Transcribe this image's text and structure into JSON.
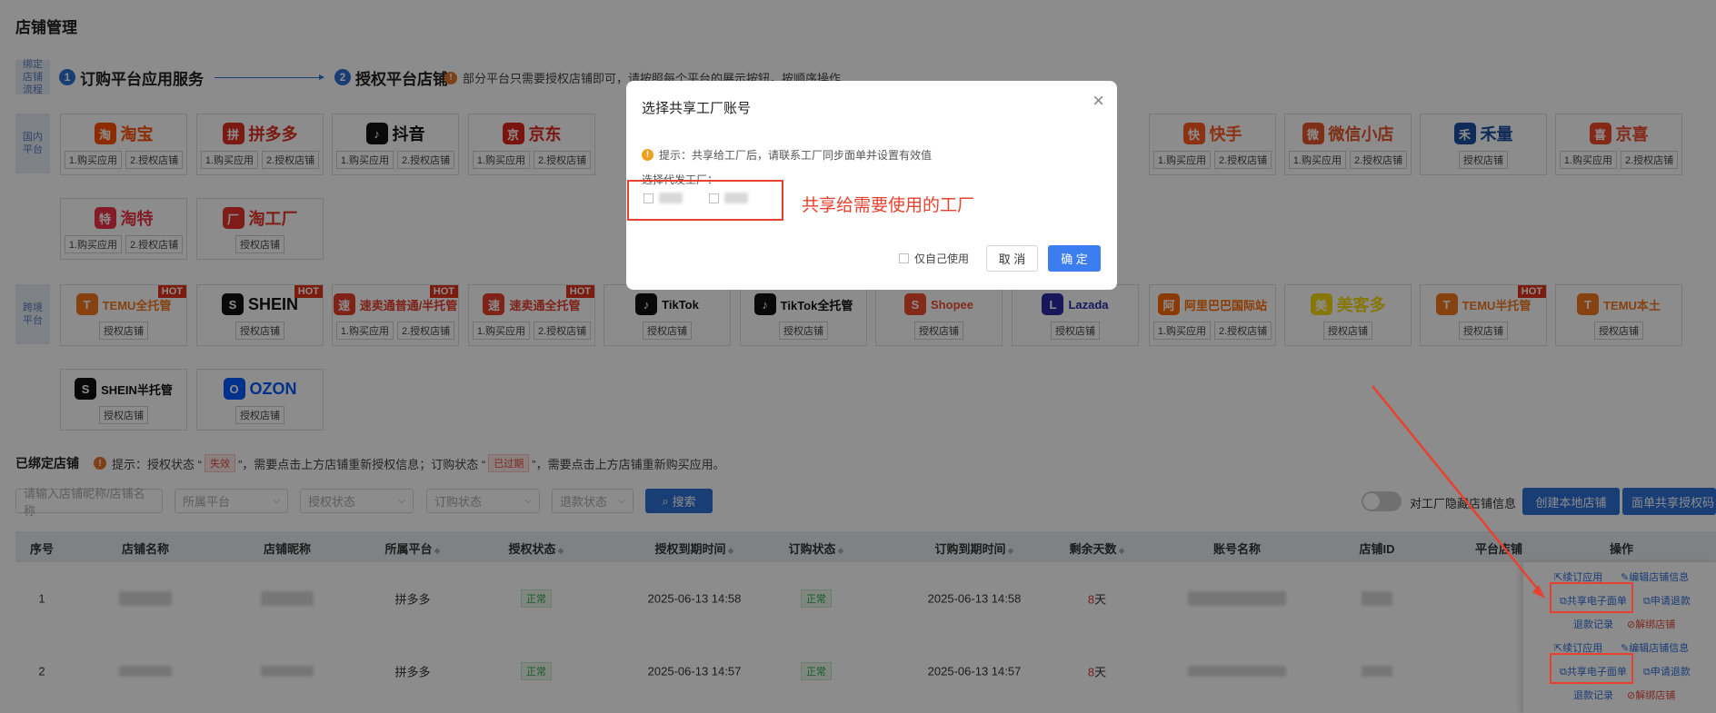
{
  "page": {
    "title": "店铺管理"
  },
  "flow": {
    "side_label": "绑定店铺流程",
    "step1": {
      "num": "1",
      "label": "订购平台应用服务"
    },
    "step2": {
      "num": "2",
      "label": "授权平台店铺"
    },
    "tip": "部分平台只需要授权店铺即可，请按照每个平台的展示按钮，按顺序操作"
  },
  "domestic": {
    "side_label": "国内平台",
    "platforms": [
      {
        "name": "淘宝",
        "mark": "淘",
        "color": "#ff5000",
        "btns": [
          "1.购买应用",
          "2.授权店铺"
        ]
      },
      {
        "name": "拼多多",
        "mark": "拼",
        "color": "#e02e24",
        "btns": [
          "1.购买应用",
          "2.授权店铺"
        ]
      },
      {
        "name": "抖音",
        "mark": "♪",
        "color": "#111111",
        "btns": [
          "1.购买应用",
          "2.授权店铺"
        ]
      },
      {
        "name": "京东",
        "mark": "京",
        "color": "#e1251b",
        "btns": [
          "1.购买应用",
          "2.授权店铺"
        ]
      },
      {
        "name": "快手",
        "mark": "快",
        "color": "#ff5a1f",
        "btns": [
          "1.购买应用",
          "2.授权店铺"
        ]
      },
      {
        "name": "微信小店",
        "mark": "微",
        "color": "#e8572a",
        "btns": [
          "1.购买应用",
          "2.授权店铺"
        ]
      },
      {
        "name": "禾量",
        "mark": "禾",
        "color": "#1d4fa5",
        "btns": [
          "授权店铺"
        ]
      },
      {
        "name": "京喜",
        "mark": "喜",
        "color": "#f04a2a",
        "btns": [
          "1.购买应用",
          "2.授权店铺"
        ]
      },
      {
        "name": "淘特",
        "mark": "特",
        "color": "#f0334a",
        "btns": [
          "1.购买应用",
          "2.授权店铺"
        ]
      },
      {
        "name": "淘工厂",
        "mark": "厂",
        "color": "#e8342a",
        "btns": [
          "授权店铺"
        ]
      }
    ]
  },
  "crossborder": {
    "side_label": "跨境平台",
    "hot": "HOT",
    "platforms": [
      {
        "name": "TEMU全托管",
        "mark": "T",
        "color": "#f47a20",
        "btns": [
          "授权店铺"
        ],
        "hot": true
      },
      {
        "name": "SHEIN",
        "mark": "S",
        "color": "#111111",
        "btns": [
          "授权店铺"
        ],
        "hot": true
      },
      {
        "name": "速卖通普通/半托管",
        "mark": "速",
        "color": "#e8412f",
        "btns": [
          "1.购买应用",
          "2.授权店铺"
        ],
        "hot": true
      },
      {
        "name": "速卖通全托管",
        "mark": "速",
        "color": "#e8412f",
        "btns": [
          "1.购买应用",
          "2.授权店铺"
        ],
        "hot": true
      },
      {
        "name": "TikTok",
        "mark": "♪",
        "color": "#111111",
        "btns": [
          "授权店铺"
        ],
        "hot": false
      },
      {
        "name": "TikTok全托管",
        "mark": "♪",
        "color": "#111111",
        "btns": [
          "授权店铺"
        ],
        "hot": false
      },
      {
        "name": "Shopee",
        "mark": "S",
        "color": "#ee4d2d",
        "btns": [
          "授权店铺"
        ],
        "hot": false
      },
      {
        "name": "Lazada",
        "mark": "L",
        "color": "#2a2aa8",
        "btns": [
          "授权店铺"
        ],
        "hot": false
      },
      {
        "name": "阿里巴巴国际站",
        "mark": "阿",
        "color": "#ff6a00",
        "btns": [
          "1.购买应用",
          "2.授权店铺"
        ],
        "hot": false
      },
      {
        "name": "美客多",
        "mark": "美",
        "color": "#f5d90a",
        "btns": [
          "授权店铺"
        ],
        "hot": false
      },
      {
        "name": "TEMU半托管",
        "mark": "T",
        "color": "#f47a20",
        "btns": [
          "授权店铺"
        ],
        "hot": true
      },
      {
        "name": "TEMU本土",
        "mark": "T",
        "color": "#f47a20",
        "btns": [
          "授权店铺"
        ],
        "hot": false
      },
      {
        "name": "SHEIN半托管",
        "mark": "S",
        "color": "#111111",
        "btns": [
          "授权店铺"
        ],
        "hot": false
      },
      {
        "name": "OZON",
        "mark": "O",
        "color": "#005bff",
        "btns": [
          "授权店铺"
        ],
        "hot": false
      }
    ]
  },
  "bound": {
    "title": "已绑定店铺",
    "tip_pre": "提示：授权状态 “",
    "tag_invalid": "失效",
    "tip_mid": "”，需要点击上方店铺重新授权信息；订购状态 “",
    "tag_expired": "已过期",
    "tip_post": "”，需要点击上方店铺重新购买应用。"
  },
  "filters": {
    "search_placeholder": "请输入店铺昵称/店铺名称",
    "platform": "所属平台",
    "auth": "授权状态",
    "order": "订购状态",
    "refund": "退款状态",
    "search_btn": "搜索",
    "toggle_label": "对工厂隐藏店铺信息",
    "create_local": "创建本地店铺",
    "share_auth": "面单共享授权码"
  },
  "table": {
    "headers": [
      "序号",
      "店铺名称",
      "店铺昵称",
      "所属平台",
      "授权状态",
      "授权到期时间",
      "订购状态",
      "订购到期时间",
      "剩余天数",
      "账号名称",
      "店铺ID",
      "平台店铺",
      "操作"
    ],
    "rows": [
      {
        "idx": "1",
        "platform": "拼多多",
        "auth": "正常",
        "auth_exp": "2025-06-13 14:58",
        "order": "正常",
        "order_exp": "2025-06-13 14:58",
        "days": "8",
        "days_unit": "天"
      },
      {
        "idx": "2",
        "platform": "拼多多",
        "auth": "正常",
        "auth_exp": "2025-06-13 14:57",
        "order": "正常",
        "order_exp": "2025-06-13 14:57",
        "days": "8",
        "days_unit": "天"
      }
    ],
    "ops": {
      "renew": "续订应用",
      "edit": "编辑店铺信息",
      "share": "共享电子面单",
      "refund_apply": "申请退款",
      "refund_log": "退款记录",
      "unbind": "解绑店铺"
    }
  },
  "modal": {
    "title": "选择共享工厂账号",
    "tip": "提示：共享给工厂后，请联系工厂同步面单并设置有效值",
    "label": "选择代发工厂：",
    "self_use": "仅自己使用",
    "cancel": "取 消",
    "ok": "确 定"
  },
  "annotation": {
    "text": "共享给需要使用的工厂"
  },
  "colors": {
    "primary": "#2f6fd6",
    "annotation": "#e8412f",
    "success": "#2da84a"
  }
}
